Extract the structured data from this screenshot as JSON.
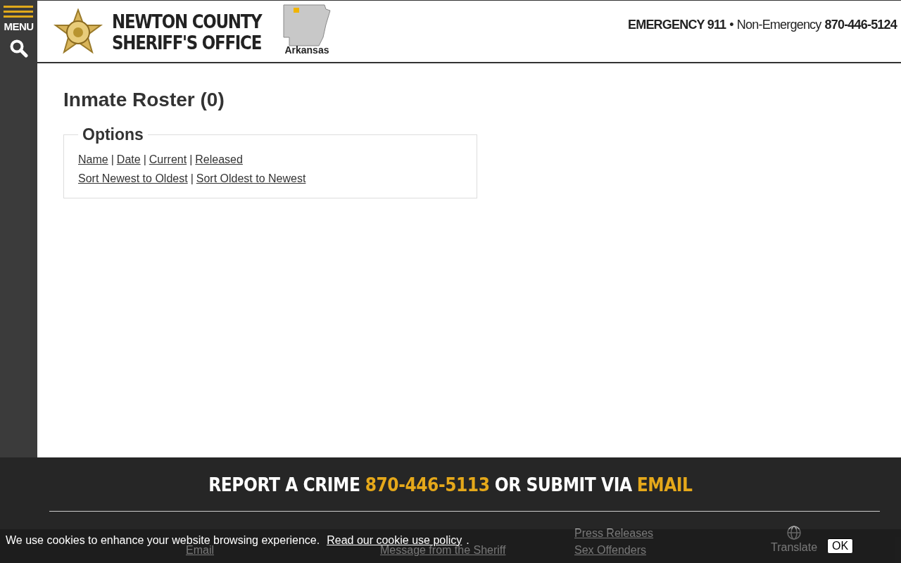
{
  "menu": {
    "label": "MENU"
  },
  "brand": {
    "title_line1": "NEWTON COUNTY",
    "title_line2": "SHERIFF'S OFFICE",
    "state": "Arkansas"
  },
  "contact": {
    "emergency": "EMERGENCY 911",
    "separator": "•",
    "non_emergency_label": "Non-Emergency",
    "non_emergency_phone": "870-446-5124"
  },
  "page": {
    "heading": "Inmate Roster (0)",
    "options_legend": "Options",
    "filter_links": [
      {
        "label": "Name"
      },
      {
        "label": "Date"
      },
      {
        "label": "Current"
      },
      {
        "label": "Released"
      }
    ],
    "sort_links": [
      {
        "label": "Sort Newest to Oldest"
      },
      {
        "label": "Sort Oldest to Newest"
      }
    ],
    "link_separator": "|"
  },
  "footer": {
    "report_text": "REPORT A CRIME",
    "report_phone": "870-446-5113",
    "report_middle": "OR SUBMIT VIA",
    "report_email": "EMAIL",
    "columns": [
      [
        "Email"
      ],
      [
        "Message from the Sheriff"
      ],
      [
        "Press Releases",
        "Sex Offenders"
      ]
    ],
    "translate": "Translate"
  },
  "cookie_bar": {
    "message": "We use cookies to enhance your website browsing experience.",
    "policy_link": "Read our cookie use policy",
    "after": ".",
    "ok": "OK"
  }
}
